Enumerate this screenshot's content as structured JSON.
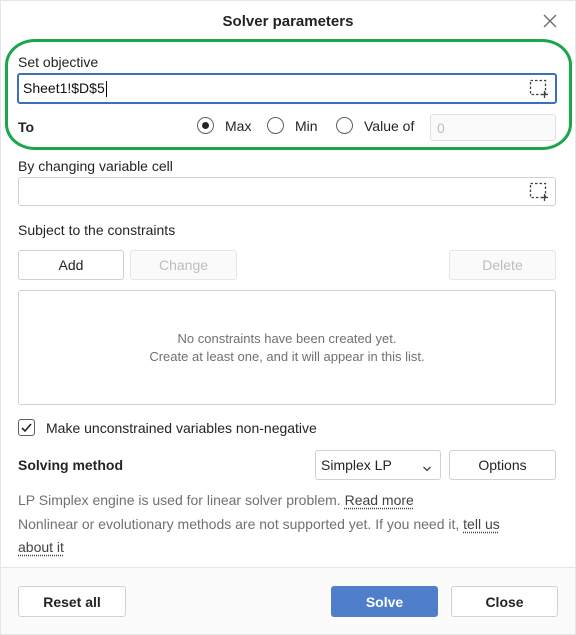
{
  "dialog": {
    "title": "Solver parameters"
  },
  "objective": {
    "label": "Set objective",
    "value": "Sheet1!$D$5",
    "to_label": "To",
    "options": [
      {
        "label": "Max",
        "selected": true
      },
      {
        "label": "Min",
        "selected": false
      },
      {
        "label": "Value of",
        "selected": false
      }
    ],
    "value_of_placeholder": "0"
  },
  "variables": {
    "label": "By changing variable cell",
    "value": ""
  },
  "constraints": {
    "label": "Subject to the constraints",
    "add_label": "Add",
    "change_label": "Change",
    "delete_label": "Delete",
    "empty_line1": "No constraints have been created yet.",
    "empty_line2": "Create at least one, and it will appear in this list."
  },
  "nonneg": {
    "label": "Make unconstrained variables non-negative",
    "checked": true
  },
  "method": {
    "label": "Solving method",
    "selected": "Simplex LP",
    "options_label": "Options"
  },
  "info": {
    "line1_text": "LP Simplex engine is used for linear solver problem.",
    "line1_link": "Read more",
    "line2_text": "Nonlinear or evolutionary methods are not supported yet. If you need it,",
    "line2_link_a": "tell us",
    "line2_link_b": "about it"
  },
  "footer": {
    "reset_label": "Reset all",
    "solve_label": "Solve",
    "close_label": "Close"
  },
  "colors": {
    "accent": "#4f7fcb",
    "focus_border": "#3f6fb6",
    "annotation_ring": "#1aa64a"
  }
}
